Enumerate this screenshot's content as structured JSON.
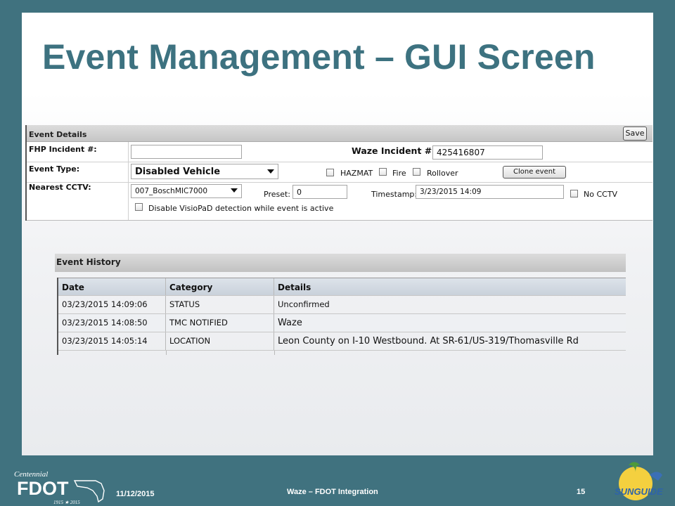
{
  "slide": {
    "title": "Event Management – GUI Screen"
  },
  "event_details": {
    "header": "Event Details",
    "save_label": "Save",
    "fhp_label": "FHP Incident #:",
    "fhp_value": "",
    "waze_label": "Waze Incident #:",
    "waze_value": "425416807",
    "type_label": "Event Type:",
    "type_value": "Disabled Vehicle",
    "hazmat_label": "HAZMAT",
    "fire_label": "Fire",
    "rollover_label": "Rollover",
    "clone_label": "Clone event",
    "cctv_label": "Nearest CCTV:",
    "cctv_value": "007_BoschMIC7000",
    "preset_label": "Preset:",
    "preset_value": "0",
    "timestamp_label": "Timestamp:",
    "timestamp_value": "3/23/2015 14:09",
    "no_cctv_label": "No CCTV",
    "visiopad_label": "Disable VisioPaD detection while event is active"
  },
  "event_history": {
    "header": "Event History",
    "columns": [
      "Date",
      "Category",
      "Details"
    ],
    "rows": [
      [
        "03/23/2015 14:09:06",
        "STATUS",
        "Unconfirmed"
      ],
      [
        "03/23/2015 14:08:50",
        "TMC NOTIFIED",
        "Waze"
      ],
      [
        "03/23/2015 14:05:14",
        "LOCATION",
        "Leon County on I-10 Westbound. At SR-61/US-319/Thomasville Rd"
      ]
    ]
  },
  "footer": {
    "date": "11/12/2015",
    "center": "Waze – FDOT Integration",
    "page": "15",
    "fdot_logo_text": "FDOT",
    "fdot_centennial": "Centennial",
    "fdot_years": "1915 ★ 2015",
    "sunguide_logo_text": "SUNGUIDE"
  },
  "colors": {
    "frame": "#40727f",
    "title": "#3d7280"
  }
}
